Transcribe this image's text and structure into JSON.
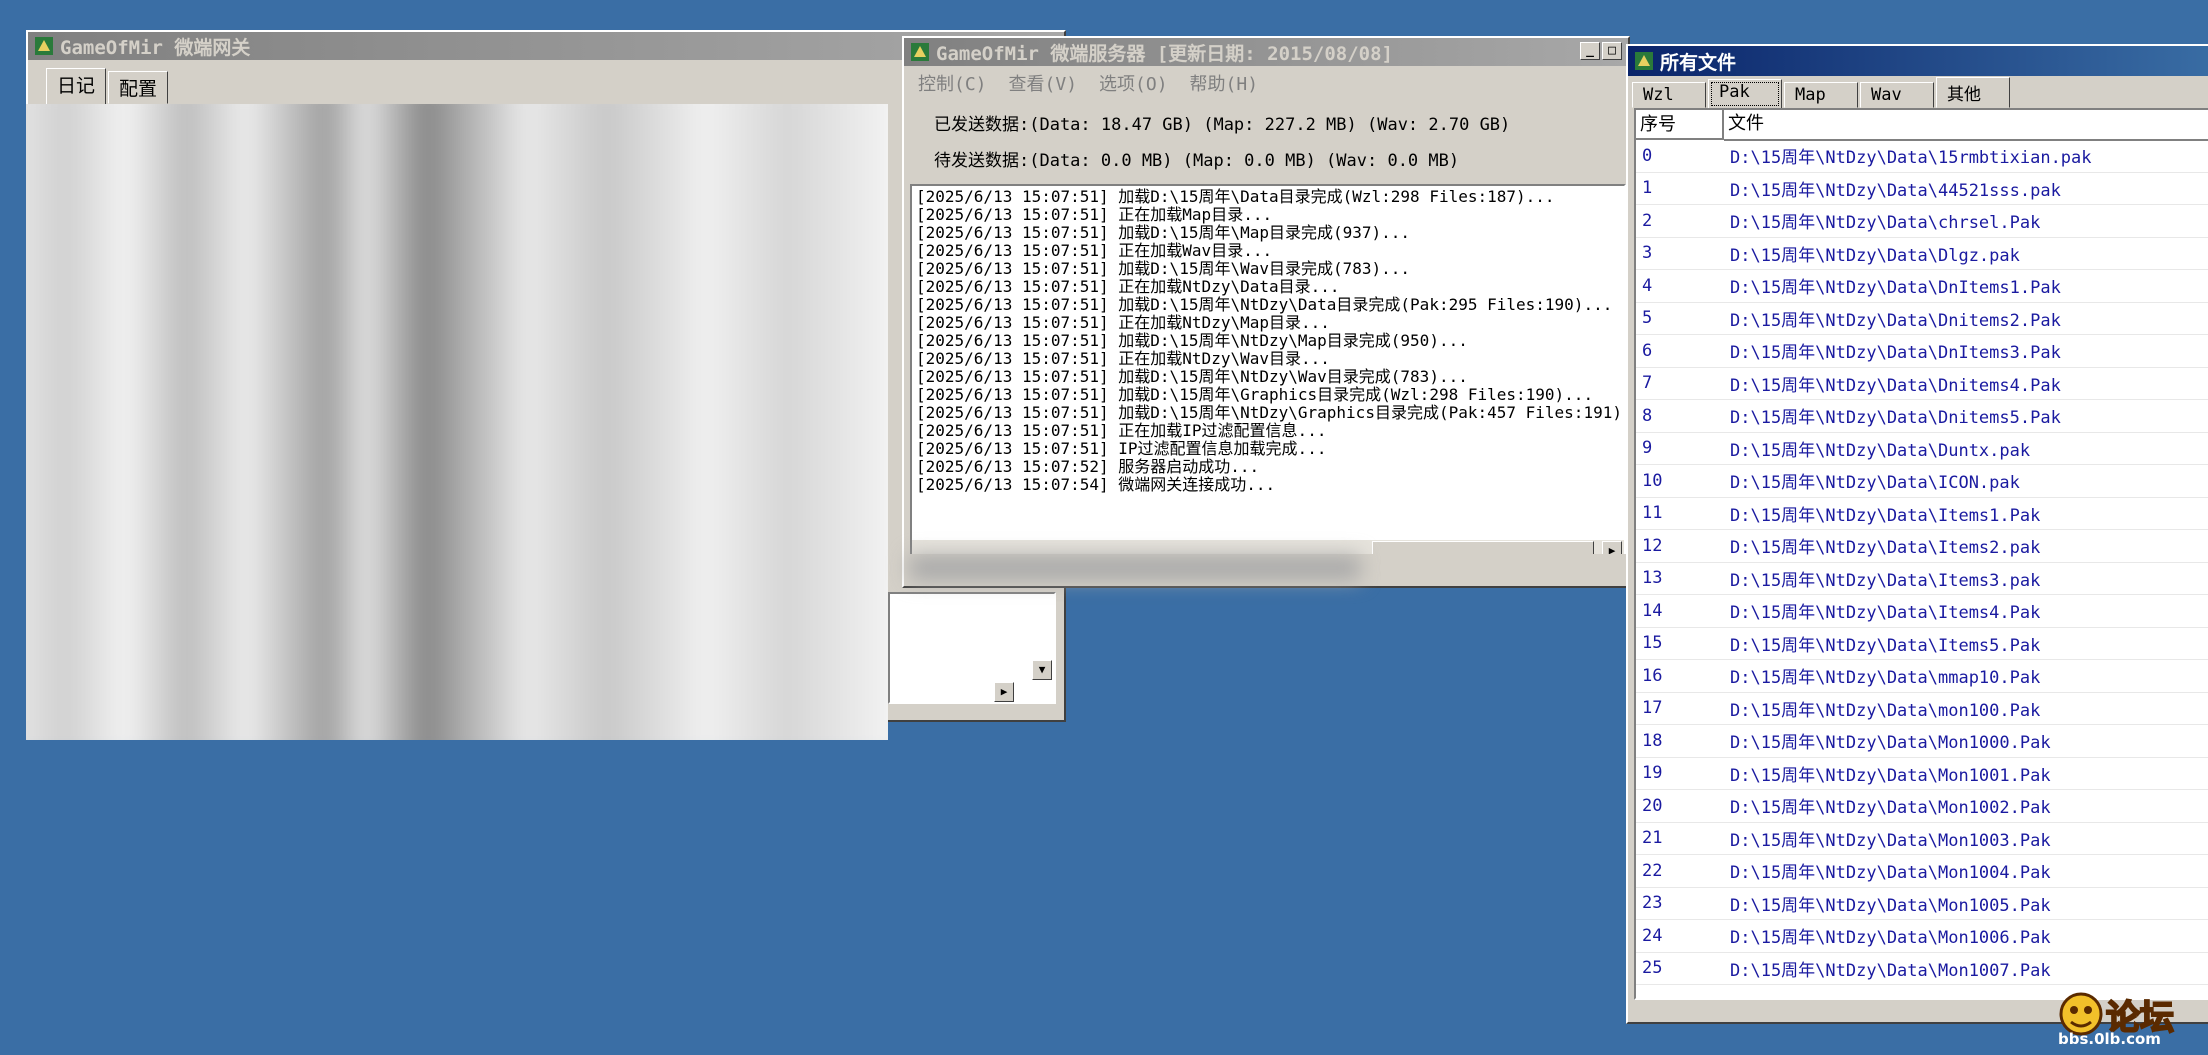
{
  "gateway": {
    "title": "GameOfMir 微端网关",
    "tabs": [
      "日记",
      "配置"
    ]
  },
  "server": {
    "title": "GameOfMir 微端服务器 [更新日期: 2015/08/08]",
    "menu": [
      "控制(C)",
      "查看(V)",
      "选项(O)",
      "帮助(H)"
    ],
    "sent": "已发送数据:(Data: 18.47 GB) (Map: 227.2 MB) (Wav: 2.70 GB)",
    "pending": "待发送数据:(Data: 0.0 MB) (Map: 0.0 MB) (Wav: 0.0 MB)",
    "log": [
      "[2025/6/13 15:07:51] 加载D:\\15周年\\Data目录完成(Wzl:298 Files:187)...",
      "[2025/6/13 15:07:51] 正在加载Map目录...",
      "[2025/6/13 15:07:51] 加载D:\\15周年\\Map目录完成(937)...",
      "[2025/6/13 15:07:51] 正在加载Wav目录...",
      "[2025/6/13 15:07:51] 加载D:\\15周年\\Wav目录完成(783)...",
      "[2025/6/13 15:07:51] 正在加载NtDzy\\Data目录...",
      "[2025/6/13 15:07:51] 加载D:\\15周年\\NtDzy\\Data目录完成(Pak:295 Files:190)...",
      "[2025/6/13 15:07:51] 正在加载NtDzy\\Map目录...",
      "[2025/6/13 15:07:51] 加载D:\\15周年\\NtDzy\\Map目录完成(950)...",
      "[2025/6/13 15:07:51] 正在加载NtDzy\\Wav目录...",
      "[2025/6/13 15:07:51] 加载D:\\15周年\\NtDzy\\Wav目录完成(783)...",
      "[2025/6/13 15:07:51] 加载D:\\15周年\\Graphics目录完成(Wzl:298 Files:190)...",
      "[2025/6/13 15:07:51] 加载D:\\15周年\\NtDzy\\Graphics目录完成(Pak:457 Files:191)...",
      "[2025/6/13 15:07:51] 正在加载IP过滤配置信息...",
      "[2025/6/13 15:07:51] IP过滤配置信息加载完成...",
      "[2025/6/13 15:07:52] 服务器启动成功...",
      "[2025/6/13 15:07:54] 微端网关连接成功..."
    ]
  },
  "files": {
    "title": "所有文件",
    "tabs": [
      "Wzl",
      "Pak",
      "Map",
      "Wav",
      "其他"
    ],
    "selected_tab": "Pak",
    "col_index": "序号",
    "col_file": "文件",
    "rows": [
      [
        "0",
        "D:\\15周年\\NtDzy\\Data\\15rmbtixian.pak"
      ],
      [
        "1",
        "D:\\15周年\\NtDzy\\Data\\44521sss.pak"
      ],
      [
        "2",
        "D:\\15周年\\NtDzy\\Data\\chrsel.Pak"
      ],
      [
        "3",
        "D:\\15周年\\NtDzy\\Data\\Dlgz.pak"
      ],
      [
        "4",
        "D:\\15周年\\NtDzy\\Data\\DnItems1.Pak"
      ],
      [
        "5",
        "D:\\15周年\\NtDzy\\Data\\Dnitems2.Pak"
      ],
      [
        "6",
        "D:\\15周年\\NtDzy\\Data\\DnItems3.Pak"
      ],
      [
        "7",
        "D:\\15周年\\NtDzy\\Data\\Dnitems4.Pak"
      ],
      [
        "8",
        "D:\\15周年\\NtDzy\\Data\\Dnitems5.Pak"
      ],
      [
        "9",
        "D:\\15周年\\NtDzy\\Data\\Duntx.pak"
      ],
      [
        "10",
        "D:\\15周年\\NtDzy\\Data\\ICON.pak"
      ],
      [
        "11",
        "D:\\15周年\\NtDzy\\Data\\Items1.Pak"
      ],
      [
        "12",
        "D:\\15周年\\NtDzy\\Data\\Items2.pak"
      ],
      [
        "13",
        "D:\\15周年\\NtDzy\\Data\\Items3.pak"
      ],
      [
        "14",
        "D:\\15周年\\NtDzy\\Data\\Items4.Pak"
      ],
      [
        "15",
        "D:\\15周年\\NtDzy\\Data\\Items5.Pak"
      ],
      [
        "16",
        "D:\\15周年\\NtDzy\\Data\\mmap10.Pak"
      ],
      [
        "17",
        "D:\\15周年\\NtDzy\\Data\\mon100.Pak"
      ],
      [
        "18",
        "D:\\15周年\\NtDzy\\Data\\Mon1000.Pak"
      ],
      [
        "19",
        "D:\\15周年\\NtDzy\\Data\\Mon1001.Pak"
      ],
      [
        "20",
        "D:\\15周年\\NtDzy\\Data\\Mon1002.Pak"
      ],
      [
        "21",
        "D:\\15周年\\NtDzy\\Data\\Mon1003.Pak"
      ],
      [
        "22",
        "D:\\15周年\\NtDzy\\Data\\Mon1004.Pak"
      ],
      [
        "23",
        "D:\\15周年\\NtDzy\\Data\\Mon1005.Pak"
      ],
      [
        "24",
        "D:\\15周年\\NtDzy\\Data\\Mon1006.Pak"
      ],
      [
        "25",
        "D:\\15周年\\NtDzy\\Data\\Mon1007.Pak"
      ]
    ]
  },
  "watermark": {
    "logo_text": "论坛",
    "url": "bbs.0lb.com"
  },
  "colors": {
    "desktop": "#3a6ea5",
    "link_text": "#1a1aa0"
  }
}
